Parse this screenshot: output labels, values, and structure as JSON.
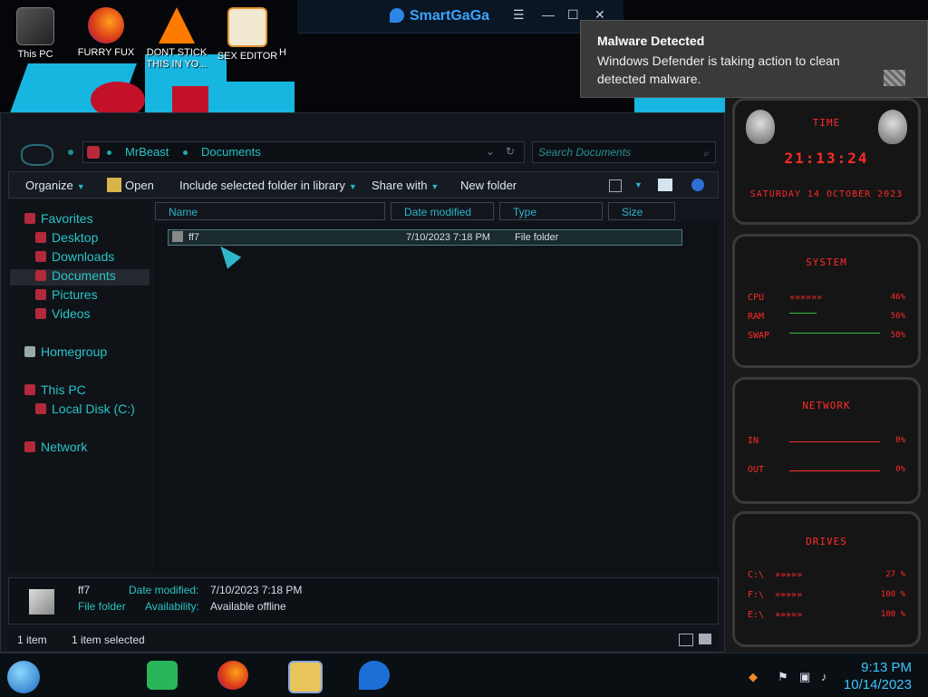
{
  "desktop_icons": [
    {
      "label": "This PC",
      "icon": "computer-icon"
    },
    {
      "label": "FURRY FUX",
      "icon": "firefox-icon"
    },
    {
      "label": "DONT STICK THIS IN YO...",
      "icon": "vlc-icon"
    },
    {
      "label": "SEX EDITOR",
      "icon": "hex-editor-icon"
    },
    {
      "label": "H",
      "icon": "app-icon"
    }
  ],
  "smartgaga": {
    "title": "SmartGaGa"
  },
  "toast": {
    "title": "Malware Detected",
    "body": "Windows Defender is taking action to clean detected malware."
  },
  "explorer": {
    "address": [
      "MrBeast",
      "Documents"
    ],
    "search_placeholder": "Search Documents",
    "toolbar": {
      "organize": "Organize",
      "open": "Open",
      "include": "Include selected folder in library",
      "share": "Share with",
      "new_folder": "New folder"
    },
    "nav": {
      "favorites": "Favorites",
      "desktop": "Desktop",
      "downloads": "Downloads",
      "documents": "Documents",
      "pictures": "Pictures",
      "videos": "Videos",
      "homegroup": "Homegroup",
      "this_pc": "This PC",
      "local_disk": "Local Disk (C:)",
      "network": "Network"
    },
    "columns": [
      "Name",
      "Date modified",
      "Type",
      "Size"
    ],
    "files": [
      {
        "name": "ff7",
        "date": "7/10/2023 7:18 PM",
        "type": "File folder",
        "size": ""
      }
    ],
    "details": {
      "name": "ff7",
      "type": "File folder",
      "date_label": "Date modified:",
      "date_value": "7/10/2023 7:18 PM",
      "avail_label": "Availability:",
      "avail_value": "Available offline"
    },
    "status": {
      "count": "1 item",
      "selected": "1 item selected"
    }
  },
  "gadgets": {
    "time": {
      "head": "TIME",
      "clock": "21:13:24",
      "date": "SATURDAY 14 OCTOBER 2023"
    },
    "system": {
      "head": "SYSTEM",
      "cpu_label": "CPU",
      "cpu": "46%",
      "ram_label": "RAM",
      "ram": "56%",
      "swap_label": "SWAP",
      "swap": "58%"
    },
    "network": {
      "head": "NETWORK",
      "in_label": "IN",
      "in": "0%",
      "out_label": "OUT",
      "out": "0%"
    },
    "drives": {
      "head": "DRIVES",
      "d1_label": "C:\\",
      "d1": "27 %",
      "d2_label": "F:\\",
      "d2": "100 %",
      "d3_label": "E:\\",
      "d3": "100 %"
    }
  },
  "taskbar": {
    "apps": [
      "notes-app-icon",
      "firefox-icon",
      "file-explorer-icon",
      "smartgaga-icon"
    ],
    "time": "9:13 PM",
    "date": "10/14/2023"
  }
}
